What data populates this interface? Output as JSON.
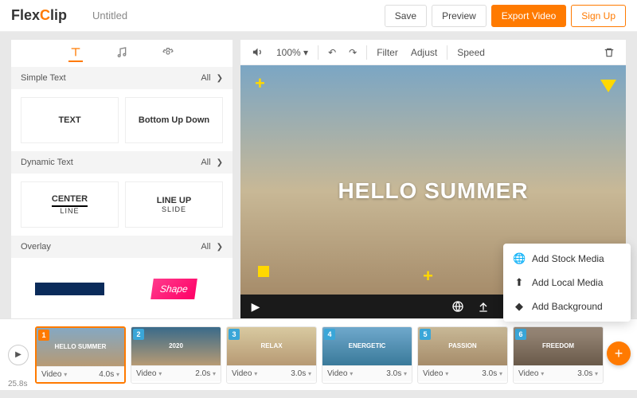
{
  "header": {
    "logo_a": "Flex",
    "logo_b": "C",
    "logo_c": "lip",
    "title": "Untitled",
    "save": "Save",
    "preview": "Preview",
    "export": "Export Video",
    "signup": "Sign Up"
  },
  "sidebar": {
    "sections": {
      "simple": {
        "title": "Simple Text",
        "all": "All"
      },
      "dynamic": {
        "title": "Dynamic Text",
        "all": "All"
      },
      "overlay": {
        "title": "Overlay",
        "all": "All"
      }
    },
    "presets": {
      "text": "TEXT",
      "bottomup": "Bottom Up Down",
      "center_top": "CENTER",
      "center_sub": "LINE",
      "lineup_top": "LINE UP",
      "lineup_sub": "SLIDE",
      "shape": "Shape"
    }
  },
  "preview": {
    "zoom": "100%",
    "filter": "Filter",
    "adjust": "Adjust",
    "speed": "Speed",
    "overlay_text": "HELLO SUMMER"
  },
  "add_menu": {
    "stock": "Add Stock Media",
    "local": "Add Local Media",
    "background": "Add Background"
  },
  "timeline": {
    "total": "25.8s",
    "clips": [
      {
        "num": "1",
        "label": "HELLO SUMMER",
        "type": "Video",
        "dur": "4.0s",
        "numbg": "#ff7a00",
        "bg": "linear-gradient(180deg,#85a8c2,#b79a74)"
      },
      {
        "num": "2",
        "label": "2020",
        "type": "Video",
        "dur": "2.0s",
        "numbg": "#3aa6d8",
        "bg": "linear-gradient(180deg,#3a6a8a,#b79a74)"
      },
      {
        "num": "3",
        "label": "RELAX",
        "type": "Video",
        "dur": "3.0s",
        "numbg": "#3aa6d8",
        "bg": "linear-gradient(180deg,#d8c9a0,#b79a74)"
      },
      {
        "num": "4",
        "label": "ENERGETIC",
        "type": "Video",
        "dur": "3.0s",
        "numbg": "#3aa6d8",
        "bg": "linear-gradient(180deg,#6fa8cc,#3a7a9a)"
      },
      {
        "num": "5",
        "label": "PASSION",
        "type": "Video",
        "dur": "3.0s",
        "numbg": "#3aa6d8",
        "bg": "linear-gradient(180deg,#c8b896,#a68c6a)"
      },
      {
        "num": "6",
        "label": "FREEDOM",
        "type": "Video",
        "dur": "3.0s",
        "numbg": "#3aa6d8",
        "bg": "linear-gradient(180deg,#9a8a7a,#6a5a4a)"
      }
    ]
  }
}
